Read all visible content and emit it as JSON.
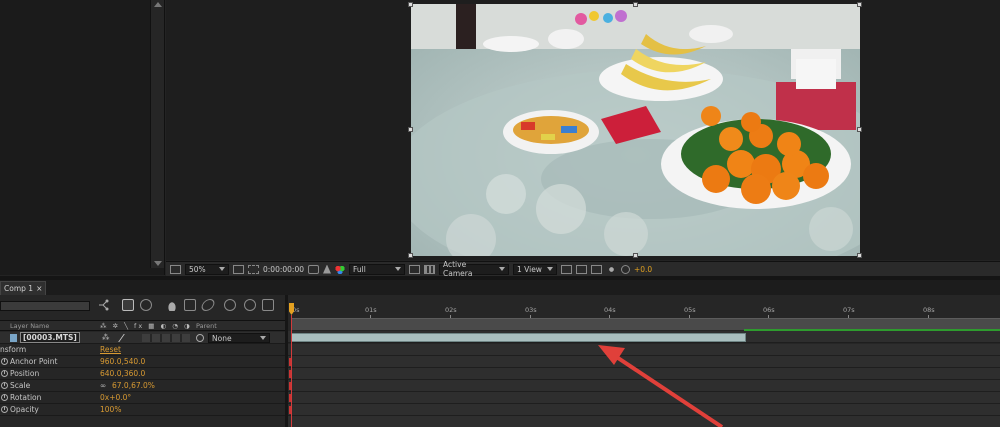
{
  "viewer": {
    "zoom": "50%",
    "timecode": "0:00:00:00",
    "resolution": "Full",
    "camera": "Active Camera",
    "view": "1 View",
    "exposure": "+0.0"
  },
  "timeline": {
    "tab_label": "Comp 1",
    "tab_close": "×",
    "header": {
      "layer_name": "Layer Name",
      "parent": "Parent"
    },
    "layer": {
      "name": "[00003.MTS]",
      "parent_value": "None"
    },
    "transform": {
      "label": "nsform",
      "reset": "Reset",
      "properties": [
        {
          "name": "Anchor Point",
          "value": "960.0,540.0"
        },
        {
          "name": "Position",
          "value": "640.0,360.0"
        },
        {
          "name": "Scale",
          "value": "67.0,67.0%"
        },
        {
          "name": "Rotation",
          "value": "0x+0.0°"
        },
        {
          "name": "Opacity",
          "value": "100%"
        }
      ]
    },
    "ruler_labels": [
      "0s",
      "01s",
      "02s",
      "03s",
      "04s",
      "05s",
      "06s",
      "07s",
      "08s"
    ]
  },
  "colors": {
    "accent": "#e4a121",
    "layer_bar": "#a9bfbf",
    "arrow": "#e0403a"
  }
}
